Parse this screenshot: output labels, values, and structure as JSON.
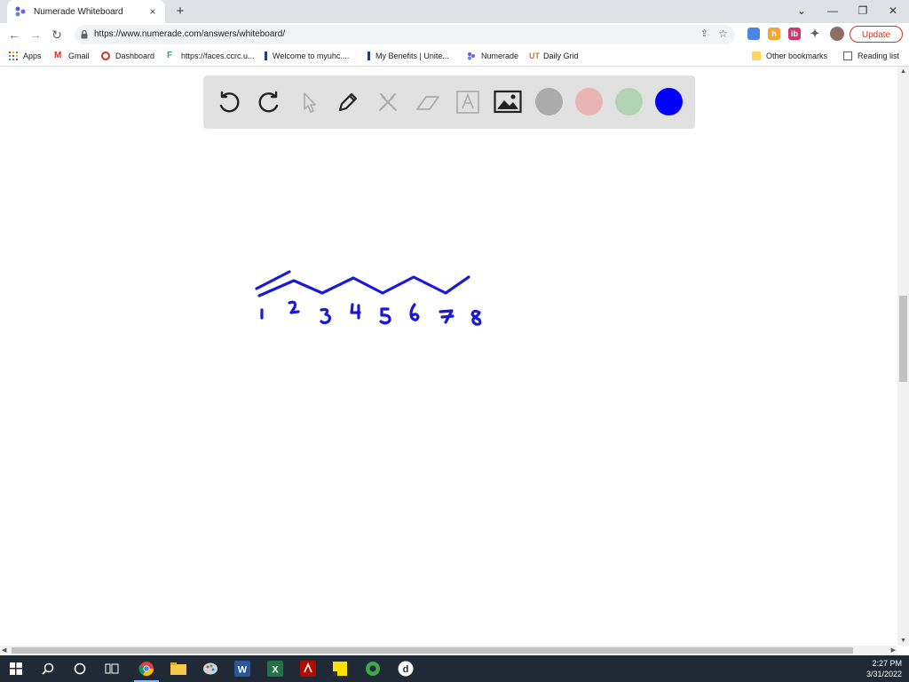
{
  "browser": {
    "tab_title": "Numerade Whiteboard",
    "tab_close": "×",
    "new_tab": "+",
    "window_controls": [
      "⌄",
      "—",
      "❐",
      "✕"
    ],
    "url": "https://www.numerade.com/answers/whiteboard/",
    "update_label": "Update"
  },
  "bookmarks": [
    {
      "label": "Apps",
      "icon": "apps-grid-icon"
    },
    {
      "label": "Gmail",
      "icon": "gmail-icon"
    },
    {
      "label": "Dashboard",
      "icon": "dashboard-icon"
    },
    {
      "label": "https://faces.ccrc.u...",
      "icon": "faces-icon"
    },
    {
      "label": "Welcome to myuhc....",
      "icon": "myuhc-icon"
    },
    {
      "label": "My Benefits | Unite...",
      "icon": "benefits-icon"
    },
    {
      "label": "Numerade",
      "icon": "numerade-icon"
    },
    {
      "label": "Daily Grid",
      "icon": "daily-grid-icon"
    }
  ],
  "bookmarks_right": [
    {
      "label": "Other bookmarks",
      "icon": "folder-icon"
    },
    {
      "label": "Reading list",
      "icon": "reading-list-icon"
    }
  ],
  "whiteboard": {
    "tools": [
      "undo-icon",
      "redo-icon",
      "pointer-icon",
      "pen-icon",
      "tools-icon",
      "eraser-icon",
      "text-icon",
      "image-icon"
    ],
    "colors": [
      "#ababab",
      "#e9b4b4",
      "#b2d4b2",
      "#0000ff"
    ],
    "selected_color": "#0000ff",
    "ink_color": "#1a1ad6"
  },
  "taskbar": {
    "apps": [
      "windows-start-icon",
      "search-icon",
      "cortana-icon",
      "task-view-icon",
      "chrome-icon",
      "file-explorer-icon",
      "paint-icon",
      "word-icon",
      "excel-icon",
      "acrobat-icon",
      "sticky-notes-icon",
      "camtasia-icon",
      "d-app-icon"
    ],
    "time": "2:27 PM",
    "date": "3/31/2022"
  }
}
